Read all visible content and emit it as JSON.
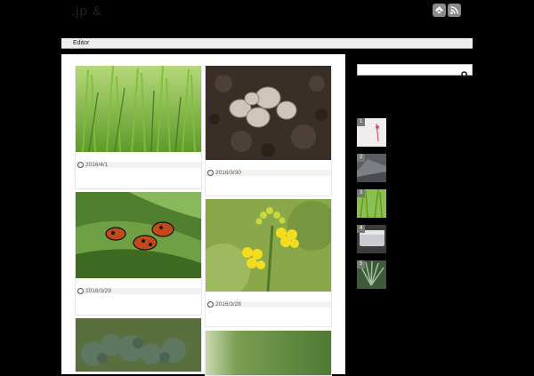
{
  "site": {
    "title": ".jp  &"
  },
  "social": [
    {
      "name": "feedly-icon"
    },
    {
      "name": "rss-icon"
    }
  ],
  "nav": {
    "items": [
      {
        "label": "Editor"
      }
    ]
  },
  "posts": [
    {
      "date": "2016/4/1",
      "image": "green-grass-photo"
    },
    {
      "date": "2016/3/30",
      "image": "seeds-on-soil-photo"
    },
    {
      "date": "2016/3/29",
      "image": "ladybugs-on-leaf-photo"
    },
    {
      "date": "2016/3/28",
      "image": "yellow-flower-photo"
    },
    {
      "image": "broccoli-photo"
    },
    {
      "image": "green-surface-photo"
    }
  ],
  "sidebar": {
    "search": {
      "placeholder": ""
    },
    "ranking": [
      {
        "num": "1"
      },
      {
        "num": "2"
      },
      {
        "num": "3"
      },
      {
        "num": "4"
      },
      {
        "num": "5"
      }
    ]
  }
}
